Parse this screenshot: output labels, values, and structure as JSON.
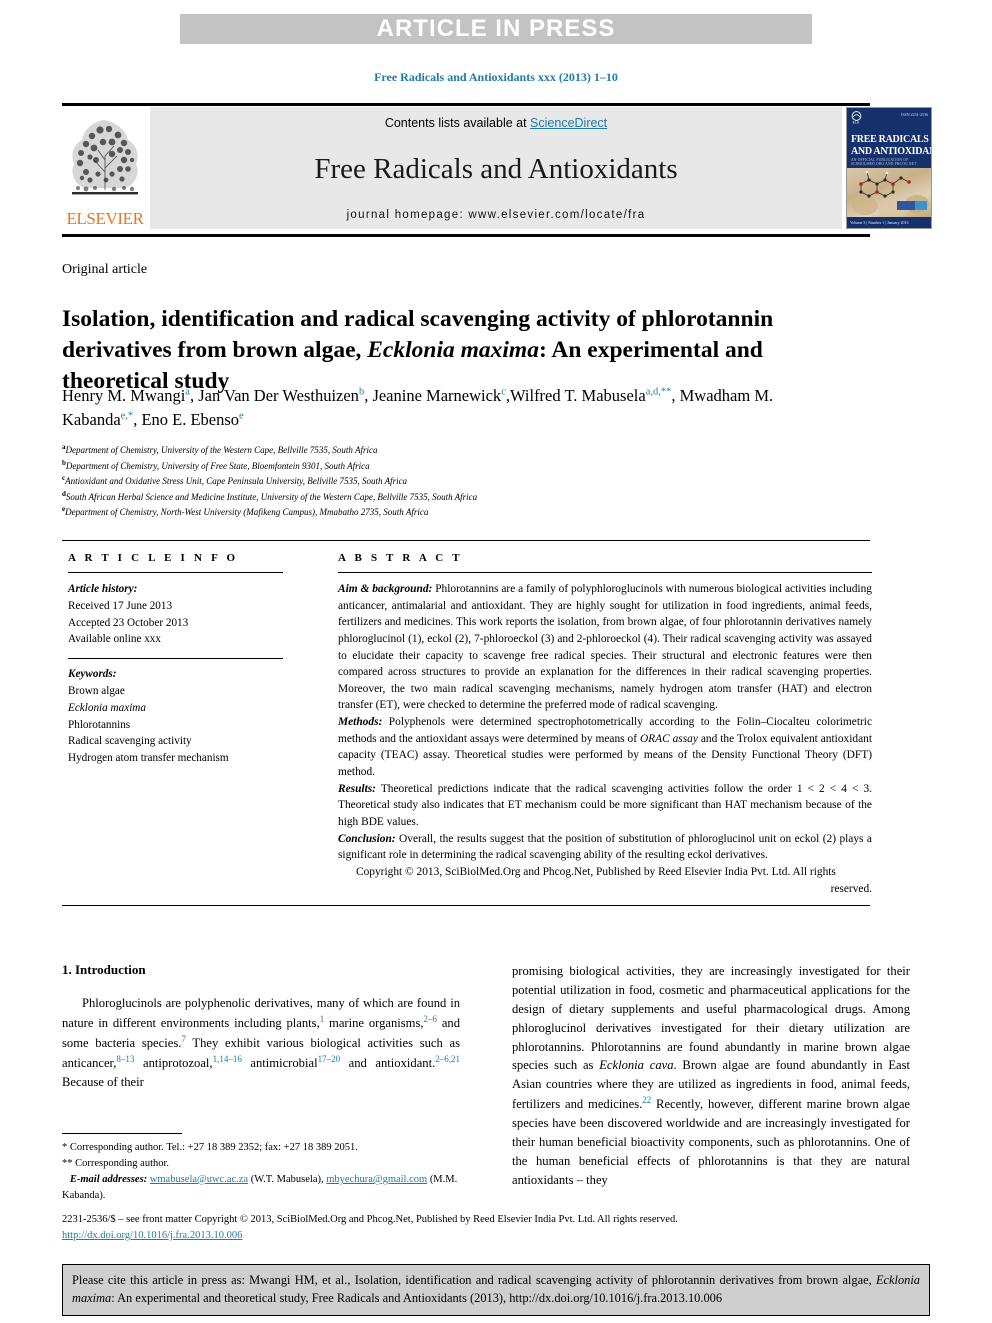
{
  "banner": {
    "text": "ARTICLE IN PRESS"
  },
  "running_head": "Free Radicals and Antioxidants xxx (2013) 1–10",
  "masthead": {
    "publisher": "ELSEVIER",
    "contents_prefix": "Contents lists available at ",
    "contents_link": "ScienceDirect",
    "journal_title": "Free Radicals and Antioxidants",
    "homepage": "journal homepage: www.elsevier.com/locate/fra",
    "cover": {
      "publisher_mark": "ELSEVIER",
      "issn": "ISSN 2231-2536",
      "title_line1": "FREE RADICALS",
      "title_line2": "AND ANTIOXIDANTS",
      "subtitle": "AN OFFICIAL PUBLICATION OF SCIBIOLMED.ORG AND PHCOG.NET",
      "footer": "Volume 3 | Number 1 | January 2013"
    }
  },
  "article": {
    "type": "Original article",
    "title_part1": "Isolation, identification and radical scavenging activity of phlorotannin derivatives from brown algae, ",
    "title_italic": "Ecklonia maxima",
    "title_part2": ": An experimental and theoretical study",
    "authors": [
      {
        "name": "Henry M. Mwangi",
        "sup": "a",
        "sep": ", "
      },
      {
        "name": "Jan Van Der Westhuizen",
        "sup": "b",
        "sep": ", "
      },
      {
        "name": "Jeanine Marnewick",
        "sup": "c",
        "sep": ","
      },
      {
        "name": "Wilfred T. Mabusela",
        "sup": "a,d,**",
        "sep": ", "
      },
      {
        "name": "Mwadham M. Kabanda",
        "sup": "e,*",
        "sep": ", "
      },
      {
        "name": "Eno E. Ebenso",
        "sup": "e",
        "sep": ""
      }
    ],
    "affiliations": [
      {
        "label": "a",
        "text": "Department of Chemistry, University of the Western Cape, Bellville 7535, South Africa"
      },
      {
        "label": "b",
        "text": "Department of Chemistry, University of Free State, Bloemfontein 9301, South Africa"
      },
      {
        "label": "c",
        "text": "Antioxidant and Oxidative Stress Unit, Cape Peninsula University, Bellville 7535, South Africa"
      },
      {
        "label": "d",
        "text": "South African Herbal Science and Medicine Institute, University of the Western Cape, Bellville 7535, South Africa"
      },
      {
        "label": "e",
        "text": "Department of Chemistry, North-West University (Mafikeng Campus), Mmabatho 2735, South Africa"
      }
    ]
  },
  "article_info": {
    "heading": "A R T I C L E  I N F O",
    "history_label": "Article history:",
    "history": [
      "Received 17 June 2013",
      "Accepted 23 October 2013",
      "Available online xxx"
    ],
    "keywords_label": "Keywords:",
    "keywords": [
      {
        "text": "Brown algae",
        "italic": false
      },
      {
        "text": "Ecklonia maxima",
        "italic": true
      },
      {
        "text": "Phlorotannins",
        "italic": false
      },
      {
        "text": "Radical scavenging activity",
        "italic": false
      },
      {
        "text": "Hydrogen atom transfer mechanism",
        "italic": false
      }
    ]
  },
  "abstract": {
    "heading": "A B S T R A C T",
    "aim_label": "Aim & background:",
    "aim_text": " Phlorotannins are a family of polyphloroglucinols with numerous biological activities including anticancer, antimalarial and antioxidant. They are highly sought for utilization in food ingredients, animal feeds, fertilizers and medicines. This work reports the isolation, from brown algae, of four phlorotannin derivatives namely phloroglucinol (1), eckol (2), 7-phloroeckol (3) and 2-phloroeckol (4). Their radical scavenging activity was assayed to elucidate their capacity to scavenge free radical species. Their structural and electronic features were then compared across structures to provide an explanation for the differences in their radical scavenging properties. Moreover, the two main radical scavenging mechanisms, namely hydrogen atom transfer (HAT) and electron transfer (ET), were checked to determine the preferred mode of radical scavenging.",
    "methods_label": "Methods:",
    "methods_text_a": " Polyphenols were determined spectrophotometrically according to the Folin–Ciocalteu colorimetric methods and the antioxidant assays were determined by means of ",
    "methods_italic": "ORAC assay",
    "methods_text_b": " and the Trolox equivalent antioxidant capacity (TEAC) assay. Theoretical studies were performed by means of the Density Functional Theory (DFT) method.",
    "results_label": "Results:",
    "results_text": " Theoretical predictions indicate that the radical scavenging activities follow the order 1 < 2 < 4 < 3. Theoretical study also indicates that ET mechanism could be more significant than HAT mechanism because of the high BDE values.",
    "conclusion_label": "Conclusion:",
    "conclusion_text": " Overall, the results suggest that the position of substitution of phloroglucinol unit on eckol (2) plays a significant role in determining the radical scavenging ability of the resulting eckol derivatives.",
    "copyright_line": "Copyright © 2013, SciBiolMed.Org and Phcog.Net, Published by Reed Elsevier India Pvt. Ltd. All rights",
    "copyright_line2": "reserved."
  },
  "body": {
    "intro_heading": "1. Introduction",
    "left_paragraph_html": "Phloroglucinols are polyphenolic derivatives, many of which are found in nature in different environments including plants,<sup>1</sup> marine organisms,<sup>2–6</sup> and some bacteria species.<sup>7</sup> They exhibit various biological activities such as anticancer,<sup>8–13</sup> antiprotozoal,<sup>1,14–16</sup> antimicrobial<sup>17–20</sup> and antioxidant.<sup>2–6,21</sup> Because of their",
    "right_paragraph_html": "promising biological activities, they are increasingly investigated for their potential utilization in food, cosmetic and pharmaceutical applications for the design of dietary supplements and useful pharmacological drugs. Among phloroglucinol derivatives investigated for their dietary utilization are phlorotannins. Phlorotannins are found abundantly in marine brown algae species such as <em>Ecklonia cava</em>. Brown algae are found abundantly in East Asian countries where they are utilized as ingredients in food, animal feeds, fertilizers and medicines.<sup>22</sup> Recently, however, different marine brown algae species have been discovered worldwide and are increasingly investigated for their human beneficial bioactivity components, such as phlorotannins. One of the human beneficial effects of phlorotannins is that they are natural antioxidants – they"
  },
  "footnotes": {
    "corresponding_1": "* Corresponding author. Tel.: +27 18 389 2352; fax: +27 18 389 2051.",
    "corresponding_2": "** Corresponding author.",
    "email_label": "E-mail addresses:",
    "email_1": "wmabusela@uwc.ac.za",
    "email_1_owner": " (W.T. Mabusela), ",
    "email_2": "mbyechura@gmail.com",
    "email_2_owner": " (M.M. Kabanda)."
  },
  "front_matter": {
    "text": "2231-2536/$ – see front matter Copyright © 2013, SciBiolMed.Org and Phcog.Net, Published by Reed Elsevier India Pvt. Ltd. All rights reserved.",
    "doi": "http://dx.doi.org/10.1016/j.fra.2013.10.006"
  },
  "cite_box": {
    "prefix": "Please cite this article in press as: Mwangi HM, et al., Isolation, identification and radical scavenging activity of phlorotannin derivatives from brown algae, ",
    "italic": "Ecklonia maxima",
    "suffix": ": An experimental and theoretical study, Free Radicals and Antioxidants (2013), http://dx.doi.org/10.1016/j.fra.2013.10.006"
  },
  "colors": {
    "link": "#1f7ba8",
    "banner_bg": "#c3c3c3",
    "masthead_bg": "#e8e8e8",
    "elsevier_orange": "#e87722",
    "cite_box_bg": "#cfcfcf"
  }
}
